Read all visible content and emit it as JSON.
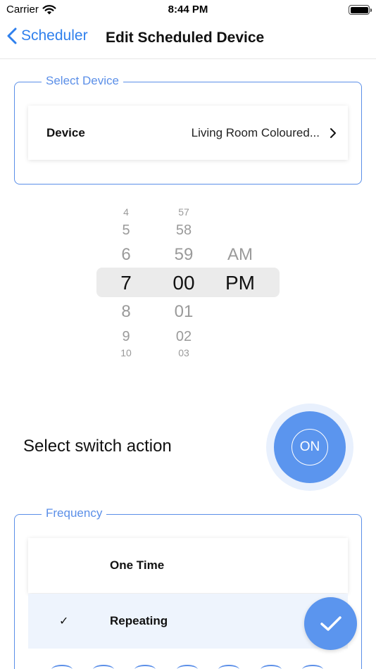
{
  "status_bar": {
    "carrier": "Carrier",
    "time": "8:44 PM"
  },
  "nav": {
    "back_label": "Scheduler",
    "title": "Edit Scheduled Device"
  },
  "device_section": {
    "legend": "Select Device",
    "device_label": "Device",
    "device_value": "Living Room Coloured..."
  },
  "time_picker": {
    "hours": [
      "4",
      "5",
      "6",
      "7",
      "8",
      "9",
      "10"
    ],
    "minutes": [
      "57",
      "58",
      "59",
      "00",
      "01",
      "02",
      "03"
    ],
    "periods": [
      "AM",
      "PM"
    ],
    "selected_hour": "7",
    "selected_minute": "00",
    "selected_period": "PM"
  },
  "switch_action": {
    "label": "Select switch action",
    "state": "ON"
  },
  "frequency": {
    "legend": "Frequency",
    "options": [
      {
        "label": "One Time",
        "selected": false
      },
      {
        "label": "Repeating",
        "selected": true
      }
    ],
    "check_mark": "✓"
  },
  "colors": {
    "accent": "#5b95ee",
    "border": "#5b8fe8",
    "link": "#2f80ed"
  },
  "icons": {
    "wifi": "wifi-icon",
    "battery": "battery-icon",
    "back": "chevron-left-icon",
    "disclosure": "chevron-right-icon",
    "confirm": "checkmark-icon"
  }
}
